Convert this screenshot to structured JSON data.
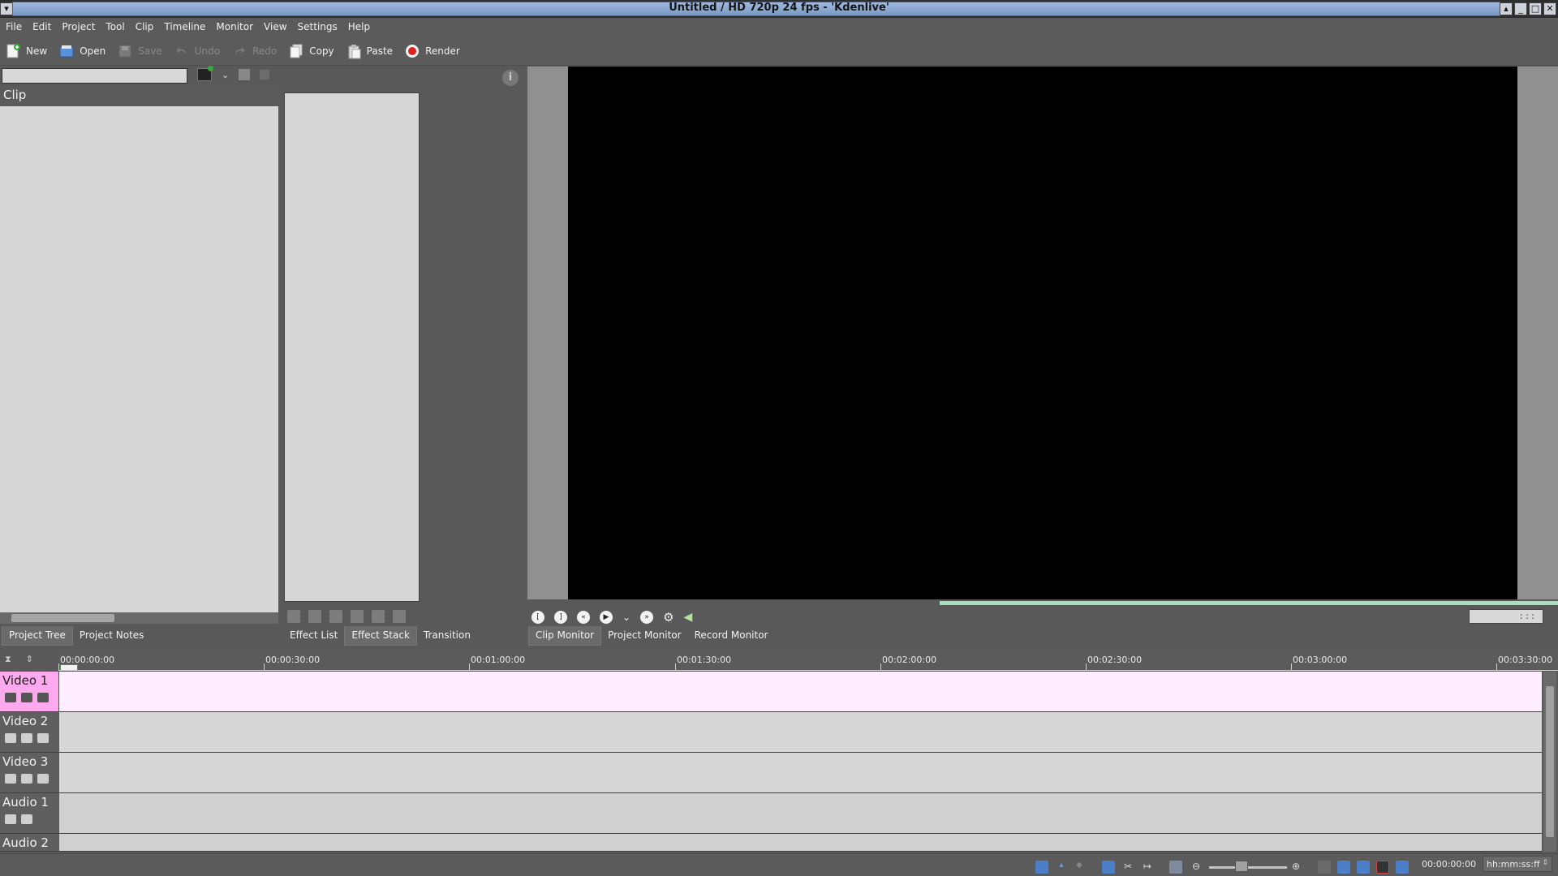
{
  "window": {
    "title": "Untitled / HD 720p 24 fps - 'Kdenlive'"
  },
  "menubar": {
    "items": [
      {
        "label": "File"
      },
      {
        "label": "Edit"
      },
      {
        "label": "Project"
      },
      {
        "label": "Tool"
      },
      {
        "label": "Clip"
      },
      {
        "label": "Timeline"
      },
      {
        "label": "Monitor"
      },
      {
        "label": "View"
      },
      {
        "label": "Settings"
      },
      {
        "label": "Help"
      }
    ]
  },
  "toolbar": {
    "new": "New",
    "open": "Open",
    "save": "Save",
    "undo": "Undo",
    "redo": "Redo",
    "copy": "Copy",
    "paste": "Paste",
    "render": "Render"
  },
  "project_tree": {
    "search_value": "",
    "column_header": "Clip"
  },
  "left_tabs": [
    "Project Tree",
    "Project Notes"
  ],
  "effect_tabs": [
    "Effect List",
    "Effect Stack",
    "Transition"
  ],
  "monitor_tabs": [
    "Clip Monitor",
    "Project Monitor",
    "Record Monitor"
  ],
  "monitor": {
    "timecode": ": : :"
  },
  "timeline": {
    "ruler": [
      "00:00:00:00",
      "00:00:30:00",
      "00:01:00:00",
      "00:01:30:00",
      "00:02:00:00",
      "00:02:30:00",
      "00:03:00:00",
      "00:03:30:00"
    ],
    "tracks": [
      {
        "name": "Video 1"
      },
      {
        "name": "Video 2"
      },
      {
        "name": "Video 3"
      },
      {
        "name": "Audio 1"
      },
      {
        "name": "Audio 2"
      }
    ]
  },
  "statusbar": {
    "time": "00:00:00:00",
    "format": "hh:mm:ss:ff"
  },
  "colors": {
    "selected_track": "#ffeeff",
    "selected_track_head": "#ffaaee",
    "render_red": "#e02020",
    "progress_green": "#a6e0bf"
  }
}
